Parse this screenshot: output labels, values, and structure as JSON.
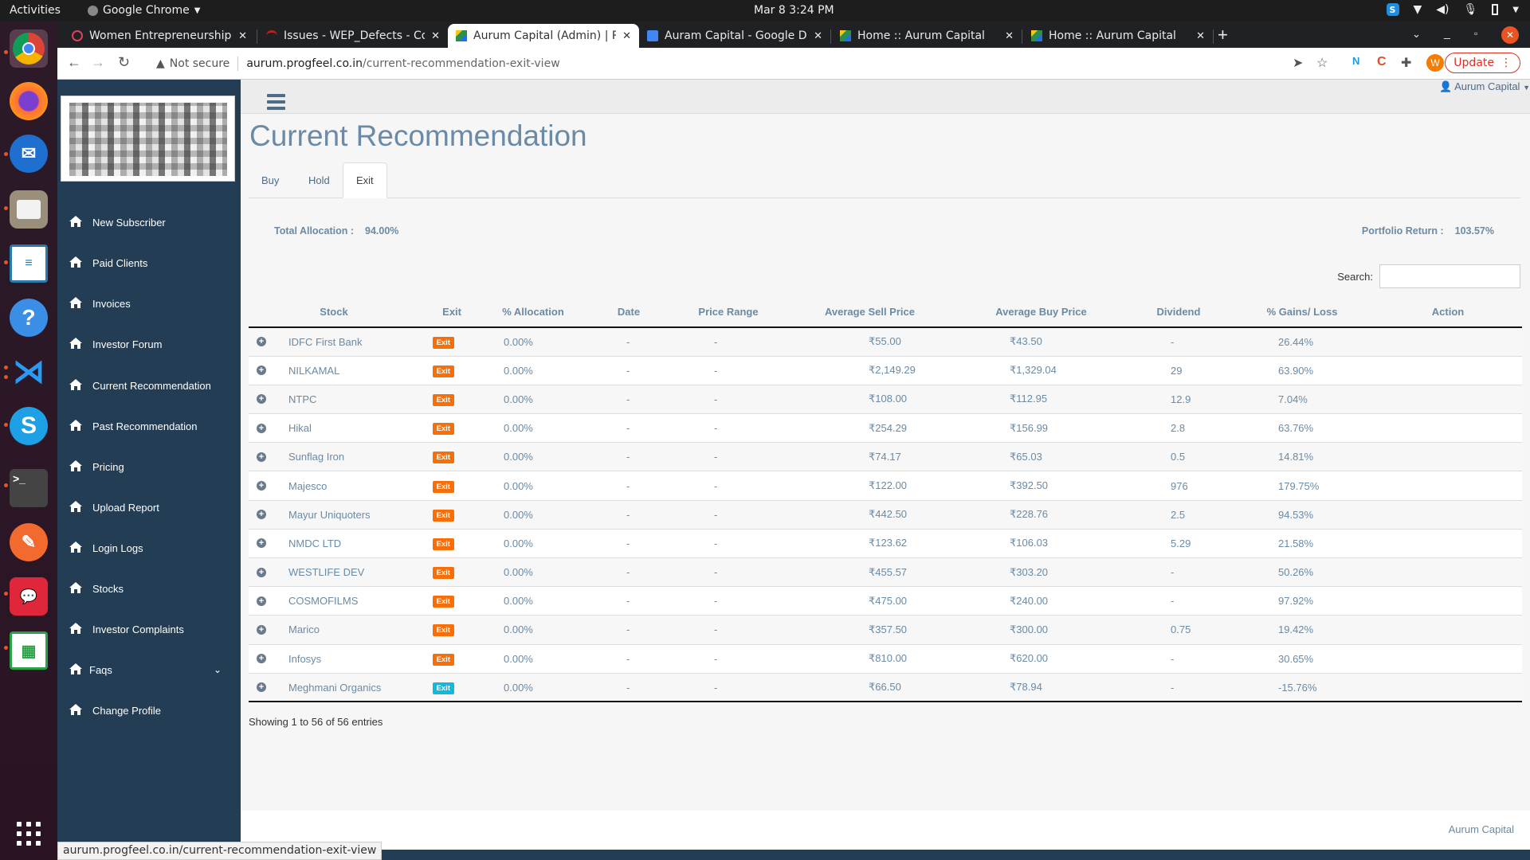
{
  "os": {
    "activities": "Activities",
    "app_name": "Google Chrome",
    "clock": "Mar 8  3:24 PM"
  },
  "browser": {
    "tabs": [
      {
        "title": "Women Entrepreneurship",
        "active": false,
        "favicon_color": "#e04060"
      },
      {
        "title": "Issues - WEP_Defects - Co",
        "active": false,
        "favicon_color": "#c0201b"
      },
      {
        "title": "Aurum Capital (Admin) | R",
        "active": true,
        "favicon_color": "#2d8f4a"
      },
      {
        "title": "Auram Capital - Google Do",
        "active": false,
        "favicon_color": "#4285f4"
      },
      {
        "title": "Home :: Aurum Capital",
        "active": false,
        "favicon_color": "#2d8f4a"
      },
      {
        "title": "Home :: Aurum Capital",
        "active": false,
        "favicon_color": "#2d8f4a"
      }
    ],
    "not_secure": "Not secure",
    "url_host": "aurum.progfeel.co.in",
    "url_path": "/current-recommendation-exit-view",
    "update_label": "Update",
    "profile_initial": "W",
    "status_url": "aurum.progfeel.co.in/current-recommendation-exit-view"
  },
  "sidebar": {
    "items": [
      {
        "label": "New Subscriber"
      },
      {
        "label": "Paid Clients"
      },
      {
        "label": "Invoices"
      },
      {
        "label": "Investor Forum"
      },
      {
        "label": "Current Recommendation"
      },
      {
        "label": "Past Recommendation"
      },
      {
        "label": "Pricing"
      },
      {
        "label": "Upload Report"
      },
      {
        "label": "Login Logs"
      },
      {
        "label": "Stocks"
      },
      {
        "label": "Investor Complaints"
      },
      {
        "label": "Faqs",
        "has_submenu": true
      },
      {
        "label": "Change Profile"
      }
    ]
  },
  "header": {
    "user": "Aurum Capital"
  },
  "page": {
    "title": "Current Recommendation",
    "tabs": [
      {
        "label": "Buy",
        "active": false
      },
      {
        "label": "Hold",
        "active": false
      },
      {
        "label": "Exit",
        "active": true
      }
    ],
    "total_allocation_label": "Total Allocation :",
    "total_allocation_value": "94.00%",
    "portfolio_return_label": "Portfolio Return :",
    "portfolio_return_value": "103.57%",
    "search_label": "Search:",
    "search_value": "",
    "showing": "Showing 1 to 56 of 56 entries",
    "footer": "Aurum Capital"
  },
  "colors": {
    "exit_badge": "#f86f0a",
    "exit_badge_alt": "#12b8dd",
    "sidebar_bg": "#233d54",
    "accent_text": "#6a8aa5"
  },
  "table": {
    "columns": [
      "",
      "Stock",
      "Exit",
      "% Allocation",
      "Date",
      "Price Range",
      "Average Sell Price",
      "Average Buy Price",
      "Dividend",
      "% Gains/ Loss",
      "Action"
    ],
    "rows": [
      {
        "stock": "IDFC First Bank",
        "exit": "Exit",
        "badge": "orange",
        "allocation": "0.00%",
        "date": "-",
        "price_range": "-",
        "avg_sell": "₹55.00",
        "avg_buy": "₹43.50",
        "dividend": "-",
        "gains": "26.44%",
        "action": ""
      },
      {
        "stock": "NILKAMAL",
        "exit": "Exit",
        "badge": "orange",
        "allocation": "0.00%",
        "date": "-",
        "price_range": "-",
        "avg_sell": "₹2,149.29",
        "avg_buy": "₹1,329.04",
        "dividend": "29",
        "gains": "63.90%",
        "action": ""
      },
      {
        "stock": "NTPC",
        "exit": "Exit",
        "badge": "orange",
        "allocation": "0.00%",
        "date": "-",
        "price_range": "-",
        "avg_sell": "₹108.00",
        "avg_buy": "₹112.95",
        "dividend": "12.9",
        "gains": "7.04%",
        "action": ""
      },
      {
        "stock": "Hikal",
        "exit": "Exit",
        "badge": "orange",
        "allocation": "0.00%",
        "date": "-",
        "price_range": "-",
        "avg_sell": "₹254.29",
        "avg_buy": "₹156.99",
        "dividend": "2.8",
        "gains": "63.76%",
        "action": ""
      },
      {
        "stock": "Sunflag Iron",
        "exit": "Exit",
        "badge": "orange",
        "allocation": "0.00%",
        "date": "-",
        "price_range": "-",
        "avg_sell": "₹74.17",
        "avg_buy": "₹65.03",
        "dividend": "0.5",
        "gains": "14.81%",
        "action": ""
      },
      {
        "stock": "Majesco",
        "exit": "Exit",
        "badge": "orange",
        "allocation": "0.00%",
        "date": "-",
        "price_range": "-",
        "avg_sell": "₹122.00",
        "avg_buy": "₹392.50",
        "dividend": "976",
        "gains": "179.75%",
        "action": ""
      },
      {
        "stock": "Mayur Uniquoters",
        "exit": "Exit",
        "badge": "orange",
        "allocation": "0.00%",
        "date": "-",
        "price_range": "-",
        "avg_sell": "₹442.50",
        "avg_buy": "₹228.76",
        "dividend": "2.5",
        "gains": "94.53%",
        "action": ""
      },
      {
        "stock": "NMDC LTD",
        "exit": "Exit",
        "badge": "orange",
        "allocation": "0.00%",
        "date": "-",
        "price_range": "-",
        "avg_sell": "₹123.62",
        "avg_buy": "₹106.03",
        "dividend": "5.29",
        "gains": "21.58%",
        "action": ""
      },
      {
        "stock": "WESTLIFE DEV",
        "exit": "Exit",
        "badge": "orange",
        "allocation": "0.00%",
        "date": "-",
        "price_range": "-",
        "avg_sell": "₹455.57",
        "avg_buy": "₹303.20",
        "dividend": "-",
        "gains": "50.26%",
        "action": ""
      },
      {
        "stock": "COSMOFILMS",
        "exit": "Exit",
        "badge": "orange",
        "allocation": "0.00%",
        "date": "-",
        "price_range": "-",
        "avg_sell": "₹475.00",
        "avg_buy": "₹240.00",
        "dividend": "-",
        "gains": "97.92%",
        "action": ""
      },
      {
        "stock": "Marico",
        "exit": "Exit",
        "badge": "orange",
        "allocation": "0.00%",
        "date": "-",
        "price_range": "-",
        "avg_sell": "₹357.50",
        "avg_buy": "₹300.00",
        "dividend": "0.75",
        "gains": "19.42%",
        "action": ""
      },
      {
        "stock": "Infosys",
        "exit": "Exit",
        "badge": "orange",
        "allocation": "0.00%",
        "date": "-",
        "price_range": "-",
        "avg_sell": "₹810.00",
        "avg_buy": "₹620.00",
        "dividend": "-",
        "gains": "30.65%",
        "action": ""
      },
      {
        "stock": "Meghmani Organics",
        "exit": "Exit",
        "badge": "cyan",
        "allocation": "0.00%",
        "date": "-",
        "price_range": "-",
        "avg_sell": "₹66.50",
        "avg_buy": "₹78.94",
        "dividend": "-",
        "gains": "-15.76%",
        "action": ""
      }
    ]
  }
}
